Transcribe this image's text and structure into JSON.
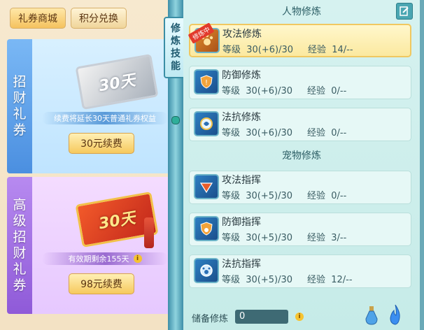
{
  "shop": {
    "tabs": [
      "礼券商城",
      "积分兑换"
    ],
    "card1": {
      "vertical_label": [
        "招",
        "财",
        "礼",
        "券"
      ],
      "ticket_text": "30天",
      "note": "续费将延长30天普通礼券权益",
      "button": "30元续费"
    },
    "card2": {
      "vertical_label": [
        "高",
        "级",
        "招",
        "财",
        "礼",
        "券"
      ],
      "ticket_text": "30天",
      "note": "有效期剩余155天",
      "button": "98元续费"
    }
  },
  "panel_title": [
    "修",
    "炼",
    "技",
    "能"
  ],
  "person_section": "人物修炼",
  "pet_section": "宠物修炼",
  "active_tag": "修炼中",
  "skills": [
    {
      "name": "攻法修炼",
      "level": "等级  30(+6)/30",
      "exp": "经验  14/--"
    },
    {
      "name": "防御修炼",
      "level": "等级  30(+6)/30",
      "exp": "经验  0/--"
    },
    {
      "name": "法抗修炼",
      "level": "等级  30(+6)/30",
      "exp": "经验  0/--"
    },
    {
      "name": "攻法指挥",
      "level": "等级  30(+5)/30",
      "exp": "经验  0/--"
    },
    {
      "name": "防御指挥",
      "level": "等级  30(+5)/30",
      "exp": "经验  3/--"
    },
    {
      "name": "法抗指挥",
      "level": "等级  30(+5)/30",
      "exp": "经验  12/--"
    }
  ],
  "reserve": {
    "label": "储备修炼",
    "value": "0"
  },
  "icons": [
    "edit-icon",
    "info-icon",
    "potion-icon",
    "flame-icon",
    "paw-icon",
    "shield-icon",
    "claw-icon",
    "orb-icon"
  ],
  "colors": {
    "active_border": "#f0c860",
    "tag_red": "#e23a2c",
    "panel_teal": "#c6ebe8"
  }
}
